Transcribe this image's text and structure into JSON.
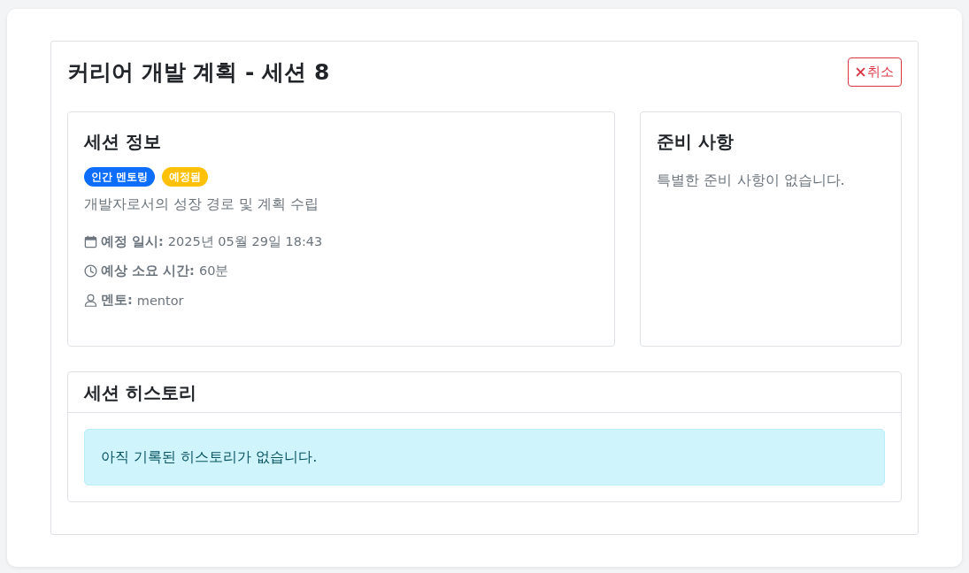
{
  "page": {
    "title": "커리어 개발 계획 - 세션 8",
    "cancel_button": {
      "label": "취소"
    }
  },
  "session_info": {
    "title": "세션 정보",
    "badges": [
      {
        "label": "인간 멘토링",
        "color": "#0d6efd"
      },
      {
        "label": "예정됨",
        "color": "#ffc107"
      }
    ],
    "description": "개발자로서의 성장 경로 및 계획 수립",
    "details": [
      {
        "kind": "calendar",
        "label": "예정 일시:",
        "value": "2025년 05월 29일 18:43"
      },
      {
        "kind": "clock",
        "label": "예상 소요 시간:",
        "value": "60분"
      },
      {
        "kind": "person",
        "label": "멘토:",
        "value": "mentor"
      }
    ]
  },
  "preparation": {
    "title": "준비 사항",
    "text": "특별한 준비 사항이 없습니다."
  },
  "history": {
    "title": "세션 히스토리",
    "message": "아직 기록된 히스토리가 없습니다."
  }
}
